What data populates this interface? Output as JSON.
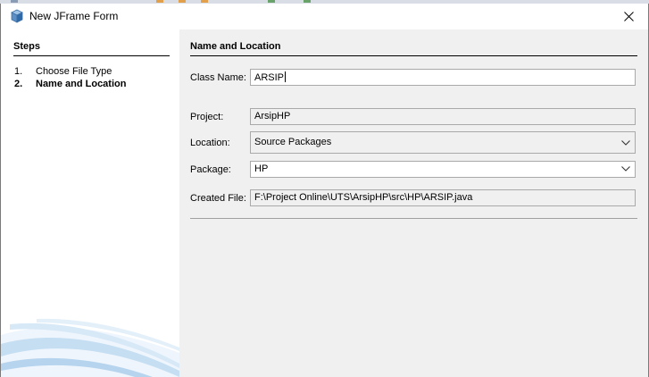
{
  "window": {
    "title": "New JFrame Form",
    "icon": "netbeans-cube-icon",
    "close_icon": "close-icon"
  },
  "steps": {
    "title": "Steps",
    "items": [
      {
        "num": "1.",
        "label": "Choose File Type",
        "current": false
      },
      {
        "num": "2.",
        "label": "Name and Location",
        "current": true
      }
    ]
  },
  "main": {
    "title": "Name and Location",
    "class_name": {
      "label": "Class Name:",
      "value": "ARSIP"
    },
    "project": {
      "label": "Project:",
      "value": "ArsipHP"
    },
    "location": {
      "label": "Location:",
      "value": "Source Packages"
    },
    "package": {
      "label": "Package:",
      "value": "HP"
    },
    "created_file": {
      "label": "Created File:",
      "value": "F:\\Project Online\\UTS\\ArsipHP\\src\\HP\\ARSIP.java"
    }
  },
  "colors": {
    "panel_bg": "#f0f0f0",
    "steps_bg": "#ffffff",
    "field_border": "#a9a9a9",
    "swoosh": "#c5def2"
  }
}
